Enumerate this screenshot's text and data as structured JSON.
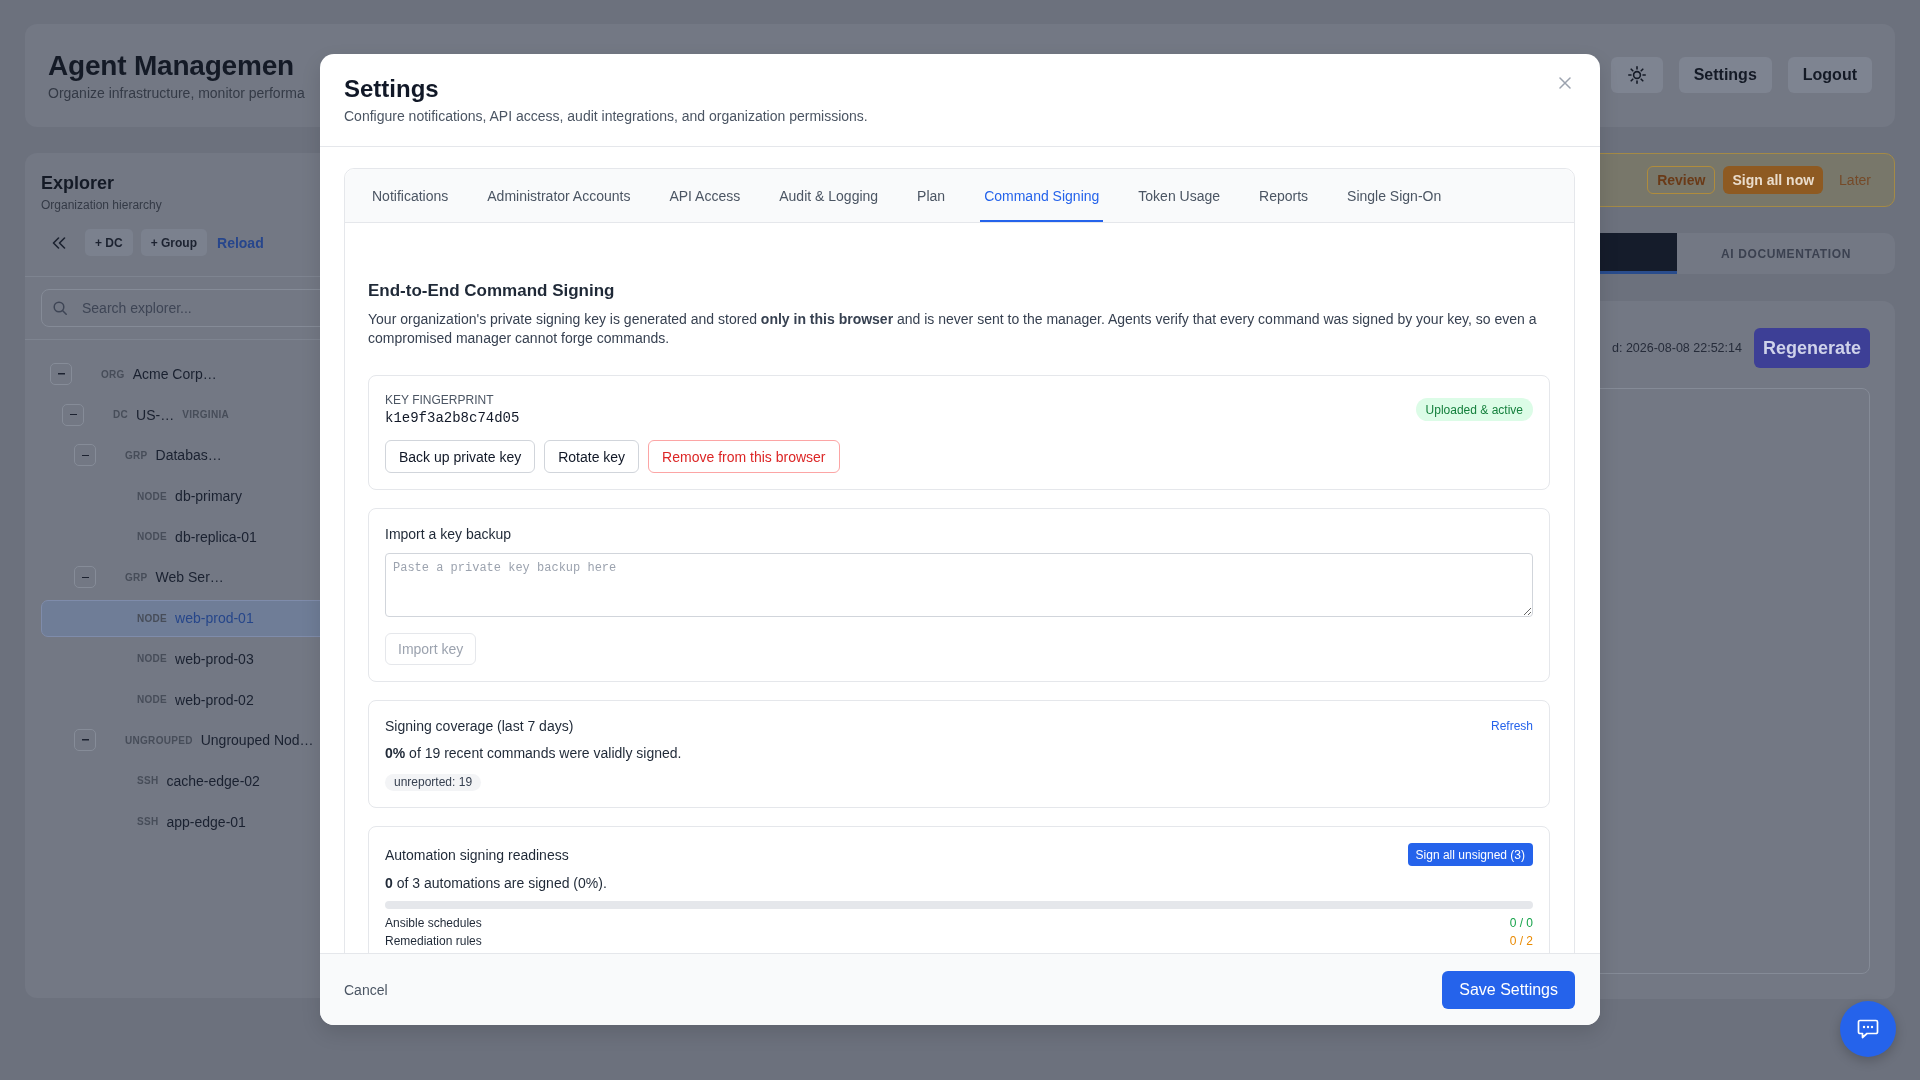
{
  "page": {
    "title": "Agent Managemen",
    "subtitle": "Organize infrastructure, monitor performa",
    "header_buttons": [
      {
        "kind": "icon"
      },
      {
        "kind": "text",
        "label": "Settings"
      },
      {
        "kind": "text",
        "label": "Logout"
      }
    ]
  },
  "explorer": {
    "title": "Explorer",
    "subtitle": "Organization hierarchy",
    "actions": [
      {
        "kind": "collapse"
      },
      {
        "kind": "chip",
        "label": "+ DC"
      },
      {
        "kind": "chip",
        "label": "+ Group"
      },
      {
        "kind": "link",
        "label": "Reload"
      }
    ],
    "search": {
      "placeholder": "Search explorer..."
    },
    "tree": [
      {
        "type": "ORG",
        "name": "Acme Corp…",
        "expanded": true,
        "selected": false,
        "children": [
          {
            "type": "DC",
            "name": "US-…",
            "region": "VIRGINIA",
            "expanded": true,
            "selected": false,
            "children": [
              {
                "type": "GRP",
                "name": "Databas…",
                "expanded": true,
                "selected": false,
                "children": [
                  {
                    "type": "NODE",
                    "name": "db-primary",
                    "selected": false
                  },
                  {
                    "type": "NODE",
                    "name": "db-replica-01",
                    "selected": false
                  }
                ]
              },
              {
                "type": "GRP",
                "name": "Web Ser…",
                "expanded": true,
                "selected": false,
                "children": [
                  {
                    "type": "NODE",
                    "name": "web-prod-01",
                    "selected": true
                  },
                  {
                    "type": "NODE",
                    "name": "web-prod-03",
                    "selected": false
                  },
                  {
                    "type": "NODE",
                    "name": "web-prod-02",
                    "selected": false
                  }
                ]
              },
              {
                "type": "UNGROUPED",
                "name": "Ungrouped Nod…",
                "expanded": true,
                "selected": false,
                "children": [
                  {
                    "type": "SSH",
                    "name": "cache-edge-02",
                    "selected": false
                  },
                  {
                    "type": "SSH",
                    "name": "app-edge-01",
                    "selected": false
                  }
                ]
              }
            ]
          }
        ]
      }
    ]
  },
  "notice": {
    "actions": [
      {
        "kind": "outline",
        "label": "Review"
      },
      {
        "kind": "filled",
        "label": "Sign all now"
      },
      {
        "kind": "text",
        "label": "Later"
      }
    ]
  },
  "view_tabs": [
    {
      "selected": true
    },
    {
      "label": "AI DOCUMENTATION",
      "selected": false
    }
  ],
  "content": {
    "timestamp": "d: 2026-08-08 22:52:14",
    "action": "Regenerate"
  },
  "settings_modal": {
    "title": "Settings",
    "subtitle": "Configure notifications, API access, audit integrations, and organization permissions.",
    "tabs": [
      {
        "label": "Notifications",
        "selected": false
      },
      {
        "label": "Administrator Accounts",
        "selected": false
      },
      {
        "label": "API Access",
        "selected": false
      },
      {
        "label": "Audit & Logging",
        "selected": false
      },
      {
        "label": "Plan",
        "selected": false
      },
      {
        "label": "Command Signing",
        "selected": true
      },
      {
        "label": "Token Usage",
        "selected": false
      },
      {
        "label": "Reports",
        "selected": false
      },
      {
        "label": "Single Sign-On",
        "selected": false
      }
    ],
    "section": {
      "title": "End-to-End Command Signing",
      "description": "Your organization's private signing key is generated and stored **only in this browser** and is never sent to the manager. Agents verify that every command was signed by your key, so even a compromised manager cannot forge commands."
    },
    "key_card": {
      "label": "KEY FINGERPRINT",
      "fingerprint": "k1e9f3a2b8c74d05",
      "status": "Uploaded & active",
      "actions": [
        {
          "kind": "default",
          "label": "Back up private key"
        },
        {
          "kind": "default",
          "label": "Rotate key"
        },
        {
          "kind": "danger",
          "label": "Remove from this browser"
        }
      ]
    },
    "import_card": {
      "title": "Import a key backup",
      "field": {
        "placeholder": "Paste a private key backup here"
      },
      "button": {
        "label": "Import key",
        "disabled": true
      }
    },
    "coverage_card": {
      "title": "Signing coverage (last 7 days)",
      "link": "Refresh",
      "summary": "**0%** of 19 recent commands were validly signed.",
      "chips": [
        "unreported: 19"
      ]
    },
    "readiness_card": {
      "title": "Automation signing readiness",
      "button": "Sign all unsigned (3)",
      "summary": "**0** of 3 automations are signed (0%).",
      "level": 0,
      "rows": [
        {
          "label": "Ansible schedules",
          "count": "0 / 0",
          "color": "#16a34a"
        },
        {
          "label": "Remediation rules",
          "count": "0 / 2",
          "color": "#ea8a00"
        }
      ]
    },
    "footer": {
      "cancel": "Cancel",
      "save": "Save Settings"
    }
  }
}
